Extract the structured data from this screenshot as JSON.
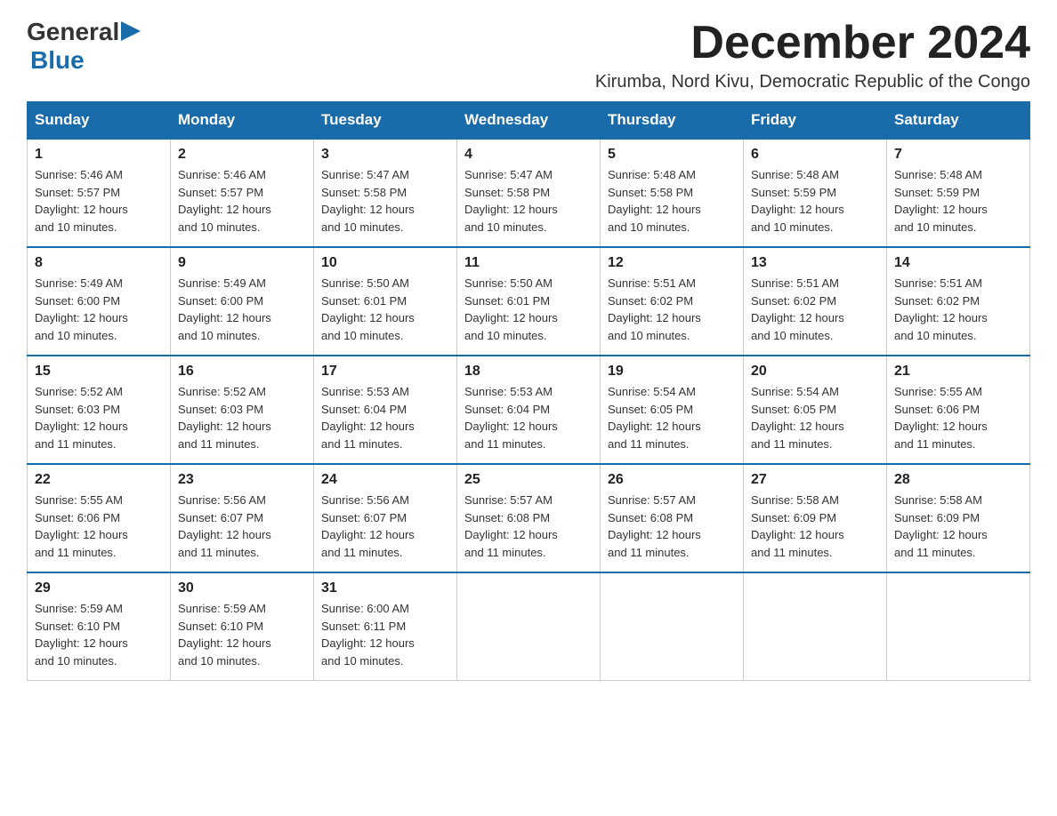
{
  "logo": {
    "general": "General",
    "arrow": "▶",
    "blue": "Blue"
  },
  "header": {
    "month_title": "December 2024",
    "subtitle": "Kirumba, Nord Kivu, Democratic Republic of the Congo"
  },
  "days_of_week": [
    "Sunday",
    "Monday",
    "Tuesday",
    "Wednesday",
    "Thursday",
    "Friday",
    "Saturday"
  ],
  "weeks": [
    [
      {
        "day": "1",
        "sunrise": "5:46 AM",
        "sunset": "5:57 PM",
        "daylight": "12 hours and 10 minutes."
      },
      {
        "day": "2",
        "sunrise": "5:46 AM",
        "sunset": "5:57 PM",
        "daylight": "12 hours and 10 minutes."
      },
      {
        "day": "3",
        "sunrise": "5:47 AM",
        "sunset": "5:58 PM",
        "daylight": "12 hours and 10 minutes."
      },
      {
        "day": "4",
        "sunrise": "5:47 AM",
        "sunset": "5:58 PM",
        "daylight": "12 hours and 10 minutes."
      },
      {
        "day": "5",
        "sunrise": "5:48 AM",
        "sunset": "5:58 PM",
        "daylight": "12 hours and 10 minutes."
      },
      {
        "day": "6",
        "sunrise": "5:48 AM",
        "sunset": "5:59 PM",
        "daylight": "12 hours and 10 minutes."
      },
      {
        "day": "7",
        "sunrise": "5:48 AM",
        "sunset": "5:59 PM",
        "daylight": "12 hours and 10 minutes."
      }
    ],
    [
      {
        "day": "8",
        "sunrise": "5:49 AM",
        "sunset": "6:00 PM",
        "daylight": "12 hours and 10 minutes."
      },
      {
        "day": "9",
        "sunrise": "5:49 AM",
        "sunset": "6:00 PM",
        "daylight": "12 hours and 10 minutes."
      },
      {
        "day": "10",
        "sunrise": "5:50 AM",
        "sunset": "6:01 PM",
        "daylight": "12 hours and 10 minutes."
      },
      {
        "day": "11",
        "sunrise": "5:50 AM",
        "sunset": "6:01 PM",
        "daylight": "12 hours and 10 minutes."
      },
      {
        "day": "12",
        "sunrise": "5:51 AM",
        "sunset": "6:02 PM",
        "daylight": "12 hours and 10 minutes."
      },
      {
        "day": "13",
        "sunrise": "5:51 AM",
        "sunset": "6:02 PM",
        "daylight": "12 hours and 10 minutes."
      },
      {
        "day": "14",
        "sunrise": "5:51 AM",
        "sunset": "6:02 PM",
        "daylight": "12 hours and 10 minutes."
      }
    ],
    [
      {
        "day": "15",
        "sunrise": "5:52 AM",
        "sunset": "6:03 PM",
        "daylight": "12 hours and 11 minutes."
      },
      {
        "day": "16",
        "sunrise": "5:52 AM",
        "sunset": "6:03 PM",
        "daylight": "12 hours and 11 minutes."
      },
      {
        "day": "17",
        "sunrise": "5:53 AM",
        "sunset": "6:04 PM",
        "daylight": "12 hours and 11 minutes."
      },
      {
        "day": "18",
        "sunrise": "5:53 AM",
        "sunset": "6:04 PM",
        "daylight": "12 hours and 11 minutes."
      },
      {
        "day": "19",
        "sunrise": "5:54 AM",
        "sunset": "6:05 PM",
        "daylight": "12 hours and 11 minutes."
      },
      {
        "day": "20",
        "sunrise": "5:54 AM",
        "sunset": "6:05 PM",
        "daylight": "12 hours and 11 minutes."
      },
      {
        "day": "21",
        "sunrise": "5:55 AM",
        "sunset": "6:06 PM",
        "daylight": "12 hours and 11 minutes."
      }
    ],
    [
      {
        "day": "22",
        "sunrise": "5:55 AM",
        "sunset": "6:06 PM",
        "daylight": "12 hours and 11 minutes."
      },
      {
        "day": "23",
        "sunrise": "5:56 AM",
        "sunset": "6:07 PM",
        "daylight": "12 hours and 11 minutes."
      },
      {
        "day": "24",
        "sunrise": "5:56 AM",
        "sunset": "6:07 PM",
        "daylight": "12 hours and 11 minutes."
      },
      {
        "day": "25",
        "sunrise": "5:57 AM",
        "sunset": "6:08 PM",
        "daylight": "12 hours and 11 minutes."
      },
      {
        "day": "26",
        "sunrise": "5:57 AM",
        "sunset": "6:08 PM",
        "daylight": "12 hours and 11 minutes."
      },
      {
        "day": "27",
        "sunrise": "5:58 AM",
        "sunset": "6:09 PM",
        "daylight": "12 hours and 11 minutes."
      },
      {
        "day": "28",
        "sunrise": "5:58 AM",
        "sunset": "6:09 PM",
        "daylight": "12 hours and 11 minutes."
      }
    ],
    [
      {
        "day": "29",
        "sunrise": "5:59 AM",
        "sunset": "6:10 PM",
        "daylight": "12 hours and 10 minutes."
      },
      {
        "day": "30",
        "sunrise": "5:59 AM",
        "sunset": "6:10 PM",
        "daylight": "12 hours and 10 minutes."
      },
      {
        "day": "31",
        "sunrise": "6:00 AM",
        "sunset": "6:11 PM",
        "daylight": "12 hours and 10 minutes."
      },
      null,
      null,
      null,
      null
    ]
  ],
  "labels": {
    "sunrise": "Sunrise:",
    "sunset": "Sunset:",
    "daylight": "Daylight:"
  }
}
